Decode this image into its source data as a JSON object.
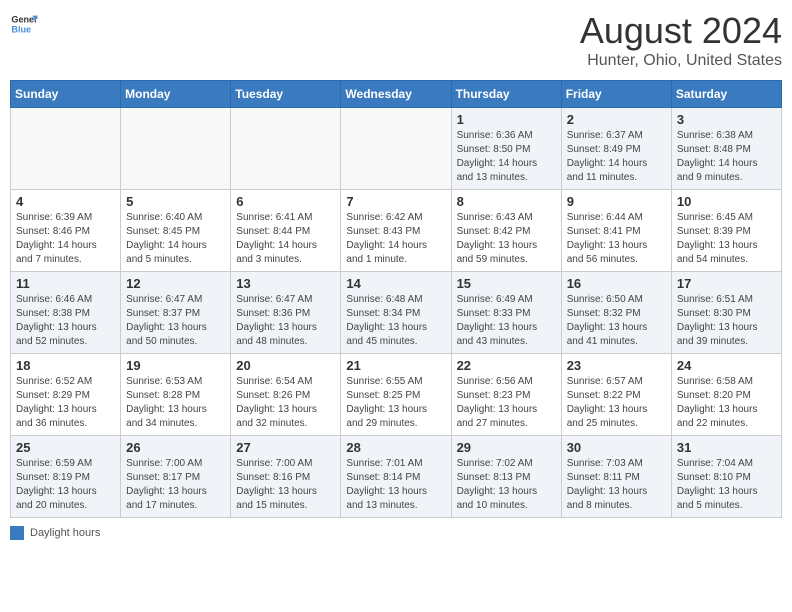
{
  "header": {
    "logo_line1": "General",
    "logo_line2": "Blue",
    "month_year": "August 2024",
    "location": "Hunter, Ohio, United States"
  },
  "weekdays": [
    "Sunday",
    "Monday",
    "Tuesday",
    "Wednesday",
    "Thursday",
    "Friday",
    "Saturday"
  ],
  "weeks": [
    [
      {
        "num": "",
        "info": ""
      },
      {
        "num": "",
        "info": ""
      },
      {
        "num": "",
        "info": ""
      },
      {
        "num": "",
        "info": ""
      },
      {
        "num": "1",
        "info": "Sunrise: 6:36 AM\nSunset: 8:50 PM\nDaylight: 14 hours\nand 13 minutes."
      },
      {
        "num": "2",
        "info": "Sunrise: 6:37 AM\nSunset: 8:49 PM\nDaylight: 14 hours\nand 11 minutes."
      },
      {
        "num": "3",
        "info": "Sunrise: 6:38 AM\nSunset: 8:48 PM\nDaylight: 14 hours\nand 9 minutes."
      }
    ],
    [
      {
        "num": "4",
        "info": "Sunrise: 6:39 AM\nSunset: 8:46 PM\nDaylight: 14 hours\nand 7 minutes."
      },
      {
        "num": "5",
        "info": "Sunrise: 6:40 AM\nSunset: 8:45 PM\nDaylight: 14 hours\nand 5 minutes."
      },
      {
        "num": "6",
        "info": "Sunrise: 6:41 AM\nSunset: 8:44 PM\nDaylight: 14 hours\nand 3 minutes."
      },
      {
        "num": "7",
        "info": "Sunrise: 6:42 AM\nSunset: 8:43 PM\nDaylight: 14 hours\nand 1 minute."
      },
      {
        "num": "8",
        "info": "Sunrise: 6:43 AM\nSunset: 8:42 PM\nDaylight: 13 hours\nand 59 minutes."
      },
      {
        "num": "9",
        "info": "Sunrise: 6:44 AM\nSunset: 8:41 PM\nDaylight: 13 hours\nand 56 minutes."
      },
      {
        "num": "10",
        "info": "Sunrise: 6:45 AM\nSunset: 8:39 PM\nDaylight: 13 hours\nand 54 minutes."
      }
    ],
    [
      {
        "num": "11",
        "info": "Sunrise: 6:46 AM\nSunset: 8:38 PM\nDaylight: 13 hours\nand 52 minutes."
      },
      {
        "num": "12",
        "info": "Sunrise: 6:47 AM\nSunset: 8:37 PM\nDaylight: 13 hours\nand 50 minutes."
      },
      {
        "num": "13",
        "info": "Sunrise: 6:47 AM\nSunset: 8:36 PM\nDaylight: 13 hours\nand 48 minutes."
      },
      {
        "num": "14",
        "info": "Sunrise: 6:48 AM\nSunset: 8:34 PM\nDaylight: 13 hours\nand 45 minutes."
      },
      {
        "num": "15",
        "info": "Sunrise: 6:49 AM\nSunset: 8:33 PM\nDaylight: 13 hours\nand 43 minutes."
      },
      {
        "num": "16",
        "info": "Sunrise: 6:50 AM\nSunset: 8:32 PM\nDaylight: 13 hours\nand 41 minutes."
      },
      {
        "num": "17",
        "info": "Sunrise: 6:51 AM\nSunset: 8:30 PM\nDaylight: 13 hours\nand 39 minutes."
      }
    ],
    [
      {
        "num": "18",
        "info": "Sunrise: 6:52 AM\nSunset: 8:29 PM\nDaylight: 13 hours\nand 36 minutes."
      },
      {
        "num": "19",
        "info": "Sunrise: 6:53 AM\nSunset: 8:28 PM\nDaylight: 13 hours\nand 34 minutes."
      },
      {
        "num": "20",
        "info": "Sunrise: 6:54 AM\nSunset: 8:26 PM\nDaylight: 13 hours\nand 32 minutes."
      },
      {
        "num": "21",
        "info": "Sunrise: 6:55 AM\nSunset: 8:25 PM\nDaylight: 13 hours\nand 29 minutes."
      },
      {
        "num": "22",
        "info": "Sunrise: 6:56 AM\nSunset: 8:23 PM\nDaylight: 13 hours\nand 27 minutes."
      },
      {
        "num": "23",
        "info": "Sunrise: 6:57 AM\nSunset: 8:22 PM\nDaylight: 13 hours\nand 25 minutes."
      },
      {
        "num": "24",
        "info": "Sunrise: 6:58 AM\nSunset: 8:20 PM\nDaylight: 13 hours\nand 22 minutes."
      }
    ],
    [
      {
        "num": "25",
        "info": "Sunrise: 6:59 AM\nSunset: 8:19 PM\nDaylight: 13 hours\nand 20 minutes."
      },
      {
        "num": "26",
        "info": "Sunrise: 7:00 AM\nSunset: 8:17 PM\nDaylight: 13 hours\nand 17 minutes."
      },
      {
        "num": "27",
        "info": "Sunrise: 7:00 AM\nSunset: 8:16 PM\nDaylight: 13 hours\nand 15 minutes."
      },
      {
        "num": "28",
        "info": "Sunrise: 7:01 AM\nSunset: 8:14 PM\nDaylight: 13 hours\nand 13 minutes."
      },
      {
        "num": "29",
        "info": "Sunrise: 7:02 AM\nSunset: 8:13 PM\nDaylight: 13 hours\nand 10 minutes."
      },
      {
        "num": "30",
        "info": "Sunrise: 7:03 AM\nSunset: 8:11 PM\nDaylight: 13 hours\nand 8 minutes."
      },
      {
        "num": "31",
        "info": "Sunrise: 7:04 AM\nSunset: 8:10 PM\nDaylight: 13 hours\nand 5 minutes."
      }
    ]
  ],
  "footer": {
    "legend_label": "Daylight hours"
  },
  "colors": {
    "header_bg": "#3a7abf",
    "alt_row_bg": "#f0f4f8"
  }
}
